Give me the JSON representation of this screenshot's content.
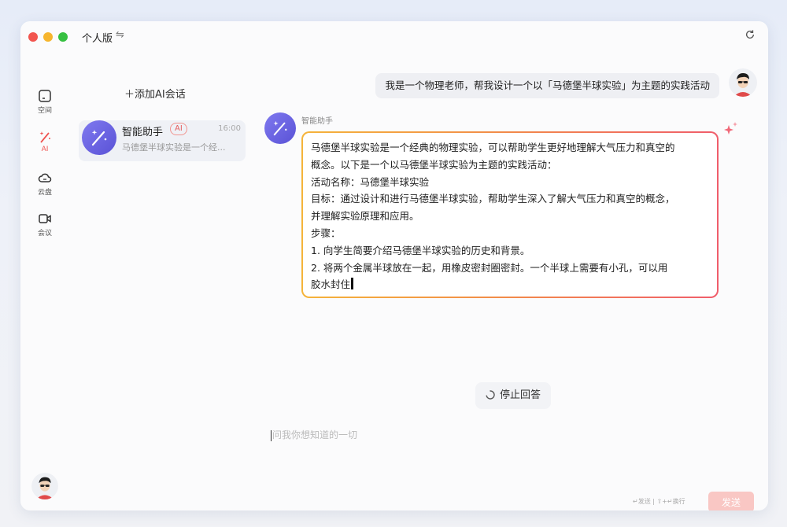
{
  "window": {
    "title": "个人版",
    "switch_icon": "⇋"
  },
  "rail": {
    "items": [
      {
        "label": "空间",
        "icon": "square-icon"
      },
      {
        "label": "AI",
        "icon": "magic-wand-icon"
      },
      {
        "label": "云盘",
        "icon": "cloud-icon"
      },
      {
        "label": "会议",
        "icon": "video-icon"
      }
    ]
  },
  "list": {
    "add_label": "＋添加AI会话",
    "conversations": [
      {
        "name": "智能助手",
        "badge": "AI",
        "time": "16:00",
        "preview": "马德堡半球实验是一个经..."
      }
    ]
  },
  "chat": {
    "user_message": "我是一个物理老师，帮我设计一个以「马德堡半球实验」为主题的实践活动",
    "bot_name": "智能助手",
    "bot_lines": [
      "马德堡半球实验是一个经典的物理实验，可以帮助学生更好地理解大气压力和真空的",
      "概念。以下是一个以马德堡半球实验为主题的实践活动：",
      "活动名称：马德堡半球实验",
      "目标：通过设计和进行马德堡半球实验，帮助学生深入了解大气压力和真空的概念，",
      "并理解实验原理和应用。",
      "步骤：",
      "1.  向学生简要介绍马德堡半球实验的历史和背景。",
      "2.  将两个金属半球放在一起，用橡皮密封圈密封。一个半球上需要有小孔，可以用",
      "胶水封住"
    ],
    "stop_label": "停止回答",
    "input_placeholder": "问我你想知道的一切",
    "hint": "↵发送 | ⇧+↵换行",
    "send_label": "发送"
  },
  "colors": {
    "accent": "#6c64e6",
    "ai_red": "#ef5350",
    "bubble_border_start": "#f5b43a",
    "bubble_border_end": "#f05d6b"
  }
}
